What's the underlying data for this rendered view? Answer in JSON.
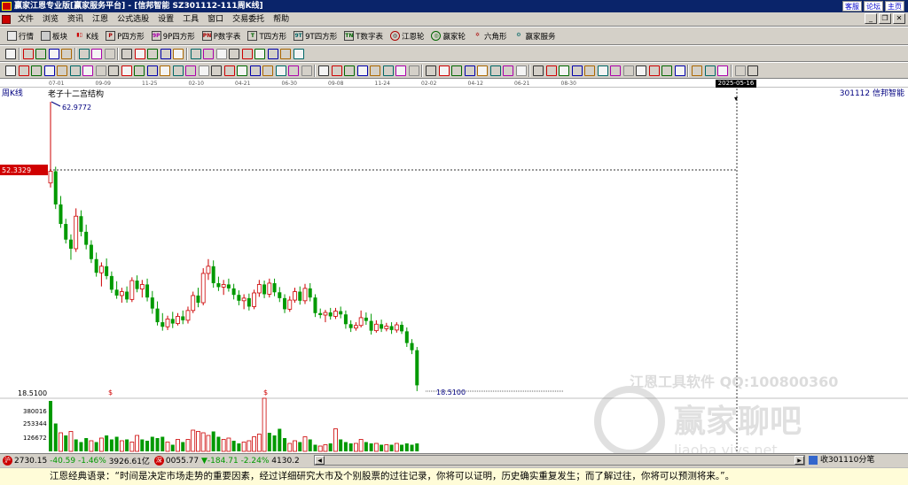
{
  "titlebar": {
    "title": "赢家江恩专业版[赢家服务平台] - [信邦智能   SZ301112-111周K线]",
    "links": [
      "客服",
      "论坛",
      "主页"
    ]
  },
  "menu": {
    "items": [
      "文件",
      "浏览",
      "资讯",
      "江恩",
      "公式选股",
      "设置",
      "工具",
      "窗口",
      "交易委托",
      "帮助"
    ]
  },
  "toolbar1": {
    "items": [
      {
        "icon": "grid-icon",
        "label": "行情"
      },
      {
        "icon": "grid-icon",
        "label": "板块"
      },
      {
        "icon": "candle-icon",
        "label": "K线"
      },
      {
        "icon": "square-icon",
        "label": "P四方形",
        "tag": "P"
      },
      {
        "icon": "square-icon",
        "label": "9P四方形",
        "tag": "9P"
      },
      {
        "icon": "square-icon",
        "label": "P数字表",
        "tag": "PN"
      },
      {
        "icon": "square-icon",
        "label": "T四方形",
        "tag": "T"
      },
      {
        "icon": "square-icon",
        "label": "9T四方形",
        "tag": "9T"
      },
      {
        "icon": "square-icon",
        "label": "T数字表",
        "tag": "TN"
      },
      {
        "icon": "wheel-icon",
        "label": "江恩轮"
      },
      {
        "icon": "wheel-icon",
        "label": "赢家轮"
      },
      {
        "icon": "star-icon",
        "label": "六角形"
      },
      {
        "icon": "service-icon",
        "label": "赢家服务"
      }
    ]
  },
  "toolbar2": {
    "select_value": "0"
  },
  "date_axis": {
    "ticks": [
      "07-01",
      "09-09",
      "11-25",
      "02-10",
      "04-21",
      "06-30",
      "09-08",
      "11-24",
      "02-02",
      "04-12",
      "06-21",
      "08-30"
    ],
    "current_date": "2025-05-16"
  },
  "chart": {
    "period_label": "周K线",
    "stock_label": "301112 信邦智能",
    "structure_label": "老子十二宫结构",
    "high_label": "62.9772",
    "low_label": "18.5100",
    "low_axis_label": "18.5100",
    "crosshair_price": "52.3329",
    "volume_ticks": [
      "380016",
      "253344",
      "126672"
    ],
    "markers": [
      "$",
      "$"
    ],
    "watermark_text": "江恩工具软件  QQ:100800360",
    "watermark_logo": "赢家聊吧",
    "watermark_sub": "liaoba.yjys.net",
    "colors": {
      "up": "#cc0000",
      "down": "#009900",
      "crosshair_label": "#d00000",
      "bg": "#ffffff"
    }
  },
  "chart_data": {
    "type": "candlestick",
    "ylim": [
      18.5,
      62.98
    ],
    "candles": [
      [
        50.5,
        62.97,
        49.8,
        52.3
      ],
      [
        52.3,
        53.0,
        46.5,
        47.2
      ],
      [
        47.2,
        48.5,
        43.6,
        44.2
      ],
      [
        44.2,
        45.0,
        41.2,
        41.8
      ],
      [
        41.8,
        42.6,
        38.7,
        40.4
      ],
      [
        40.4,
        46.6,
        39.9,
        45.4
      ],
      [
        45.4,
        46.3,
        42.3,
        43.0
      ],
      [
        43.0,
        44.1,
        40.3,
        41.0
      ],
      [
        41.0,
        41.7,
        38.2,
        38.8
      ],
      [
        38.8,
        39.8,
        36.1,
        36.7
      ],
      [
        36.7,
        38.3,
        34.6,
        37.7
      ],
      [
        37.7,
        38.9,
        35.7,
        36.2
      ],
      [
        36.2,
        36.9,
        33.6,
        34.1
      ],
      [
        34.1,
        35.4,
        32.7,
        33.2
      ],
      [
        33.2,
        34.4,
        32.1,
        33.8
      ],
      [
        33.8,
        34.6,
        32.1,
        32.6
      ],
      [
        32.6,
        36.0,
        32.2,
        35.5
      ],
      [
        35.5,
        36.3,
        33.7,
        34.2
      ],
      [
        34.2,
        35.6,
        32.9,
        34.9
      ],
      [
        34.9,
        35.8,
        32.3,
        32.9
      ],
      [
        32.9,
        33.9,
        30.4,
        31.2
      ],
      [
        31.2,
        32.3,
        28.6,
        29.1
      ],
      [
        29.1,
        30.5,
        27.8,
        28.4
      ],
      [
        28.4,
        30.1,
        27.9,
        29.6
      ],
      [
        29.6,
        30.7,
        28.2,
        28.9
      ],
      [
        28.9,
        30.5,
        28.6,
        30.0
      ],
      [
        30.0,
        30.9,
        28.8,
        29.4
      ],
      [
        29.4,
        31.5,
        28.9,
        30.9
      ],
      [
        30.9,
        33.8,
        30.5,
        33.2
      ],
      [
        33.2,
        34.4,
        31.4,
        32.1
      ],
      [
        32.1,
        37.4,
        31.7,
        36.6
      ],
      [
        36.6,
        38.8,
        35.6,
        37.7
      ],
      [
        37.7,
        38.6,
        34.4,
        35.1
      ],
      [
        35.1,
        36.1,
        33.9,
        34.5
      ],
      [
        34.5,
        35.6,
        33.3,
        34.9
      ],
      [
        34.9,
        35.8,
        33.8,
        34.3
      ],
      [
        34.3,
        35.0,
        32.6,
        33.3
      ],
      [
        33.3,
        34.0,
        31.7,
        32.4
      ],
      [
        32.4,
        33.4,
        31.1,
        32.8
      ],
      [
        32.8,
        33.5,
        30.9,
        31.5
      ],
      [
        31.5,
        34.1,
        31.1,
        33.6
      ],
      [
        33.6,
        35.6,
        33.0,
        34.9
      ],
      [
        34.9,
        35.5,
        32.8,
        33.4
      ],
      [
        33.4,
        35.8,
        32.9,
        35.1
      ],
      [
        35.1,
        35.8,
        33.1,
        33.7
      ],
      [
        33.7,
        34.5,
        32.2,
        32.8
      ],
      [
        32.8,
        33.4,
        30.5,
        31.1
      ],
      [
        31.1,
        33.1,
        30.7,
        32.5
      ],
      [
        32.5,
        34.4,
        32.1,
        33.8
      ],
      [
        33.8,
        34.6,
        31.8,
        32.4
      ],
      [
        32.4,
        35.0,
        31.9,
        34.3
      ],
      [
        34.3,
        35.1,
        32.3,
        32.9
      ],
      [
        32.9,
        33.4,
        29.9,
        30.5
      ],
      [
        30.5,
        31.2,
        29.7,
        30.2
      ],
      [
        30.2,
        31.0,
        29.1,
        30.6
      ],
      [
        30.6,
        31.3,
        29.5,
        30.0
      ],
      [
        30.0,
        31.3,
        29.6,
        30.8
      ],
      [
        30.8,
        31.5,
        29.7,
        30.3
      ],
      [
        30.3,
        30.9,
        28.1,
        28.8
      ],
      [
        28.8,
        29.4,
        27.6,
        28.2
      ],
      [
        28.2,
        29.1,
        27.8,
        28.6
      ],
      [
        28.6,
        30.9,
        28.3,
        29.8
      ],
      [
        29.8,
        30.6,
        28.7,
        29.3
      ],
      [
        29.3,
        30.4,
        27.2,
        27.8
      ],
      [
        27.8,
        29.4,
        27.5,
        28.8
      ],
      [
        28.8,
        29.5,
        27.6,
        28.1
      ],
      [
        28.1,
        29.0,
        27.7,
        28.5
      ],
      [
        28.5,
        29.1,
        27.3,
        27.9
      ],
      [
        27.9,
        29.1,
        27.5,
        28.7
      ],
      [
        28.7,
        29.2,
        27.3,
        27.7
      ],
      [
        27.7,
        28.3,
        25.3,
        25.9
      ],
      [
        25.9,
        26.5,
        24.2,
        24.8
      ],
      [
        24.8,
        25.3,
        18.51,
        19.4
      ]
    ],
    "volume": [
      [
        190000,
        0
      ],
      [
        105000,
        0
      ],
      [
        70000,
        1
      ],
      [
        60000,
        0
      ],
      [
        75000,
        1
      ],
      [
        45000,
        0
      ],
      [
        35000,
        0
      ],
      [
        50000,
        0
      ],
      [
        40000,
        1
      ],
      [
        35000,
        0
      ],
      [
        50000,
        1
      ],
      [
        60000,
        0
      ],
      [
        45000,
        0
      ],
      [
        55000,
        0
      ],
      [
        40000,
        1
      ],
      [
        45000,
        0
      ],
      [
        35000,
        1
      ],
      [
        60000,
        1
      ],
      [
        45000,
        0
      ],
      [
        40000,
        0
      ],
      [
        55000,
        0
      ],
      [
        50000,
        0
      ],
      [
        55000,
        0
      ],
      [
        35000,
        1
      ],
      [
        25000,
        0
      ],
      [
        45000,
        1
      ],
      [
        35000,
        0
      ],
      [
        45000,
        1
      ],
      [
        80000,
        1
      ],
      [
        75000,
        1
      ],
      [
        70000,
        1
      ],
      [
        60000,
        1
      ],
      [
        75000,
        0
      ],
      [
        55000,
        0
      ],
      [
        45000,
        1
      ],
      [
        50000,
        1
      ],
      [
        40000,
        0
      ],
      [
        30000,
        0
      ],
      [
        35000,
        1
      ],
      [
        40000,
        1
      ],
      [
        55000,
        1
      ],
      [
        65000,
        1
      ],
      [
        200000,
        1
      ],
      [
        70000,
        0
      ],
      [
        60000,
        0
      ],
      [
        85000,
        0
      ],
      [
        50000,
        0
      ],
      [
        30000,
        1
      ],
      [
        40000,
        1
      ],
      [
        35000,
        0
      ],
      [
        55000,
        1
      ],
      [
        45000,
        0
      ],
      [
        25000,
        0
      ],
      [
        20000,
        1
      ],
      [
        25000,
        1
      ],
      [
        30000,
        0
      ],
      [
        85000,
        1
      ],
      [
        45000,
        0
      ],
      [
        35000,
        0
      ],
      [
        30000,
        0
      ],
      [
        30000,
        1
      ],
      [
        45000,
        1
      ],
      [
        35000,
        0
      ],
      [
        30000,
        0
      ],
      [
        30000,
        1
      ],
      [
        25000,
        0
      ],
      [
        25000,
        1
      ],
      [
        25000,
        0
      ],
      [
        30000,
        1
      ],
      [
        25000,
        0
      ],
      [
        30000,
        0
      ],
      [
        25000,
        0
      ],
      [
        30000,
        0
      ]
    ]
  },
  "status": {
    "index1_icon": "沪",
    "index1": "2730.15",
    "index1_change": "-40.59",
    "index1_pct": "-1.46%",
    "index1_amount": "3926.61亿",
    "index2_icon": "深",
    "index2": "0055.77",
    "index2_change": "▼-184.71",
    "index2_pct": "-2.24%",
    "index2_amount": "4130.2",
    "right_text": "收301110分笔"
  },
  "quote": {
    "text": "江恩经典语录：“时间是决定市场走势的重要因素，经过详细研究大市及个别股票的过往记录，你将可以证明，历史确实重复发生；而了解过往，你将可以预测将来。”。"
  }
}
